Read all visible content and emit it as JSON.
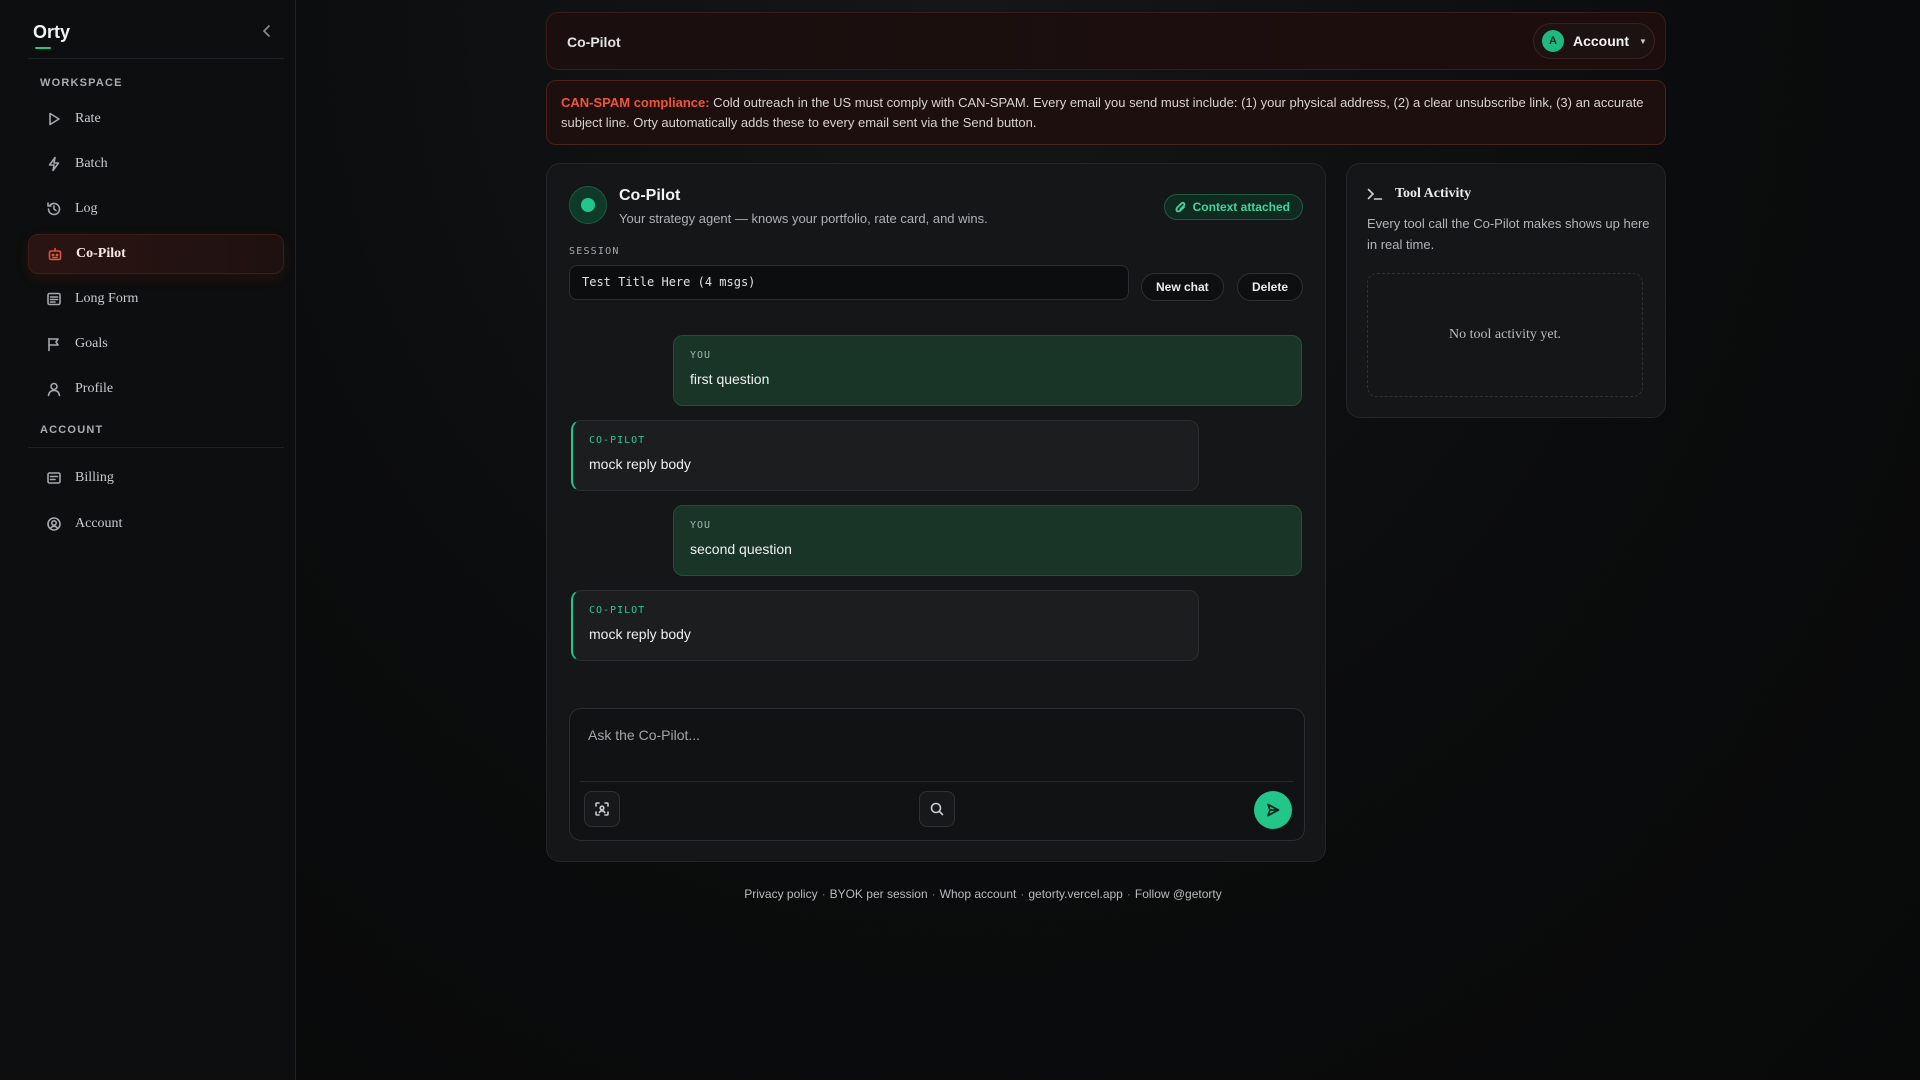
{
  "app": {
    "brand": "Orty"
  },
  "sidebar": {
    "sections": [
      {
        "label": "WORKSPACE"
      },
      {
        "label": "ACCOUNT"
      }
    ],
    "items": [
      {
        "label": "Rate",
        "icon": "play-icon"
      },
      {
        "label": "Batch",
        "icon": "bolt-icon"
      },
      {
        "label": "Log",
        "icon": "history-icon"
      },
      {
        "label": "Co-Pilot",
        "icon": "bot-icon",
        "active": true
      },
      {
        "label": "Long Form",
        "icon": "document-icon"
      },
      {
        "label": "Goals",
        "icon": "flag-icon"
      },
      {
        "label": "Profile",
        "icon": "user-icon"
      },
      {
        "label": "Billing",
        "icon": "card-icon"
      },
      {
        "label": "Account",
        "icon": "account-circle-icon"
      }
    ]
  },
  "header": {
    "title": "Co-Pilot",
    "account": {
      "avatar_initial": "A",
      "label": "Account"
    }
  },
  "banner": {
    "key": "CAN-SPAM compliance:",
    "text": " Cold outreach in the US must comply with CAN-SPAM. Every email you send must include: (1) your physical address, (2) a clear unsubscribe link, (3) an accurate subject line. Orty automatically adds these to every email sent via the Send button."
  },
  "copilot": {
    "title": "Co-Pilot",
    "subtitle": "Your strategy agent — knows your portfolio, rate card, and wins.",
    "context_badge": "Context attached",
    "session_label": "SESSION",
    "session_value": "Test Title Here (4 msgs)",
    "new_chat_label": "New chat",
    "delete_label": "Delete",
    "messages": [
      {
        "role": "YOU",
        "text": "first question"
      },
      {
        "role": "CO-PILOT",
        "text": "mock reply body"
      },
      {
        "role": "YOU",
        "text": "second question"
      },
      {
        "role": "CO-PILOT",
        "text": "mock reply body"
      }
    ],
    "composer": {
      "placeholder": "Ask the Co-Pilot..."
    }
  },
  "tool_activity": {
    "title": "Tool Activity",
    "description": "Every tool call the Co-Pilot makes shows up here in real time.",
    "empty": "No tool activity yet."
  },
  "footer": {
    "links": [
      "Privacy policy",
      "BYOK per session",
      "Whop account",
      "getorty.vercel.app",
      "Follow @getorty"
    ]
  },
  "colors": {
    "accent": "#22c58a",
    "danger": "#f0553a"
  }
}
